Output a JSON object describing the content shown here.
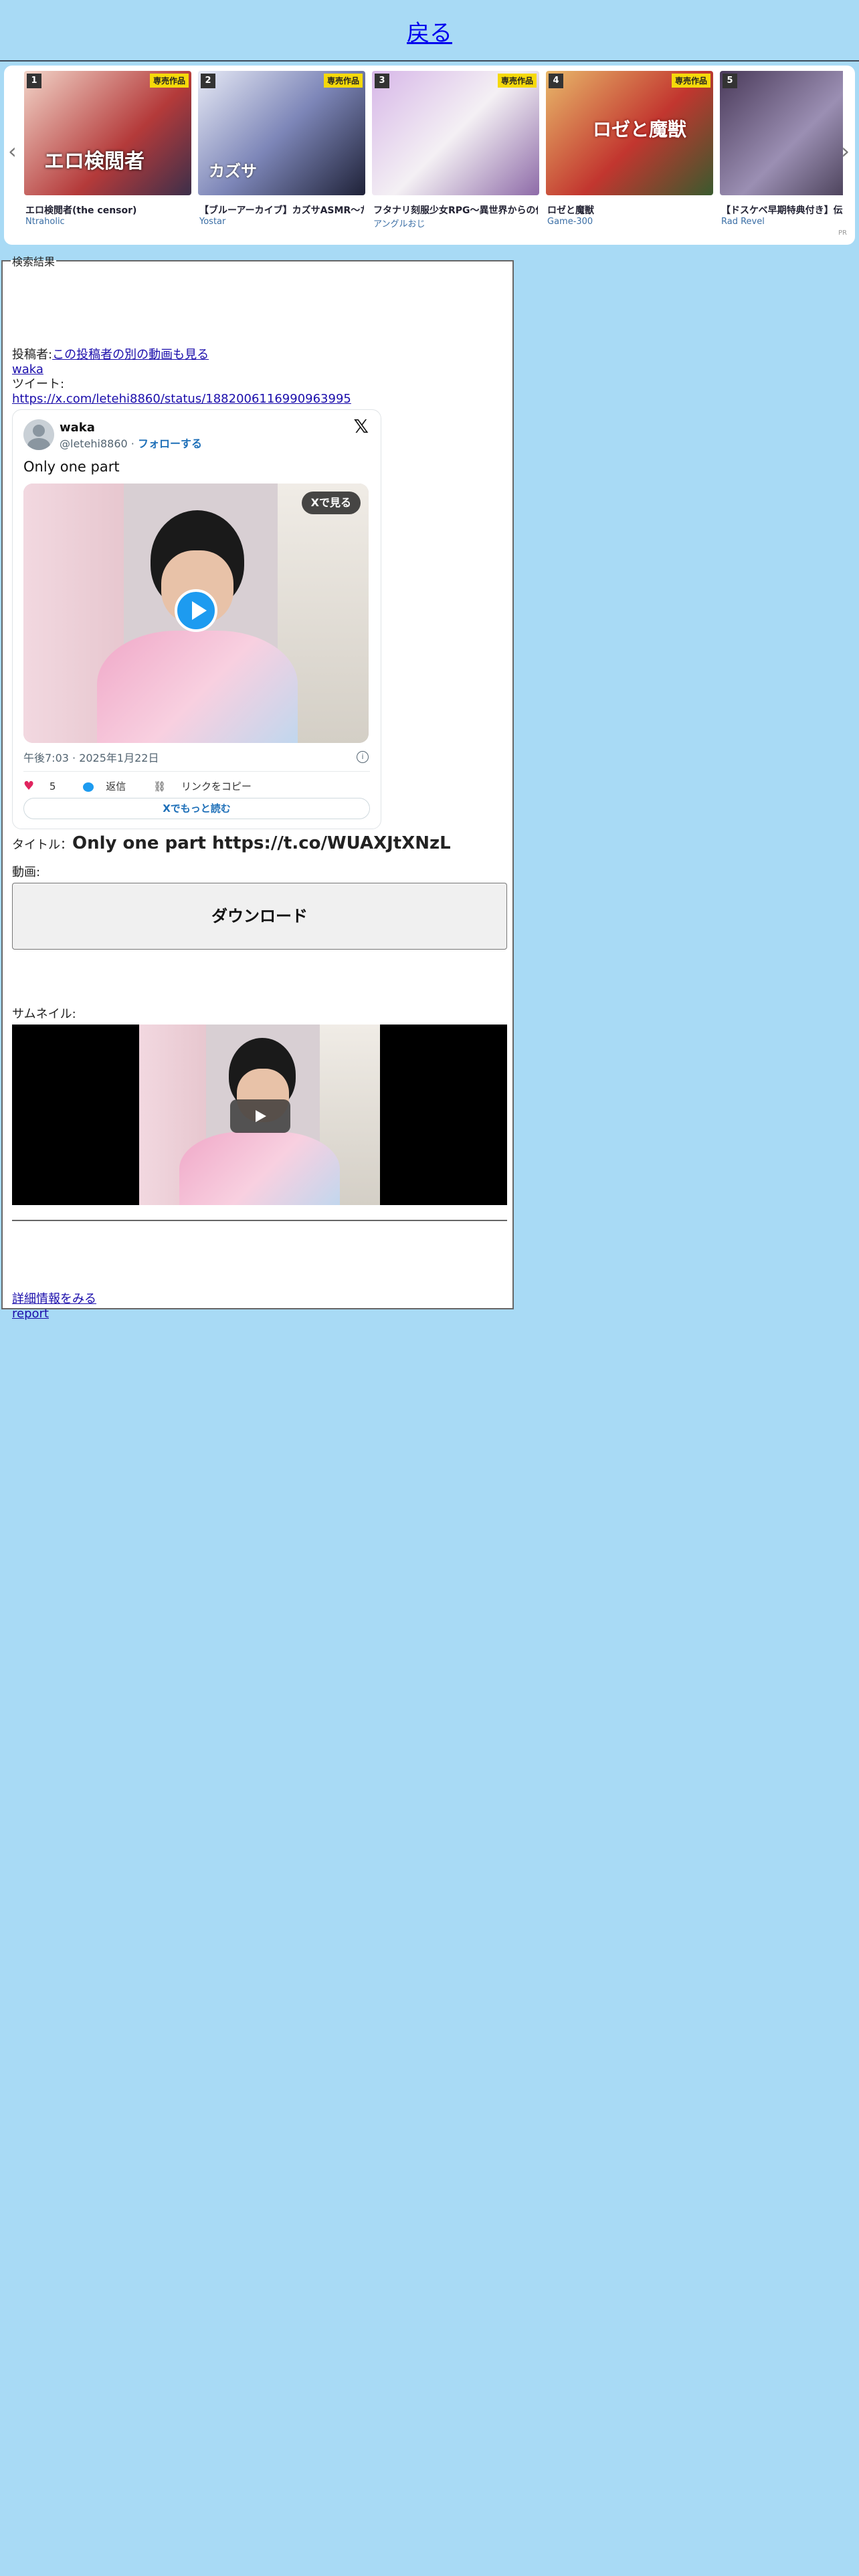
{
  "header": {
    "back_label": "戻る"
  },
  "carousel": {
    "pr_label": "PR",
    "badge_label": "専売作品",
    "items": [
      {
        "rank": "1",
        "title": "エロ検閲者(the censor)",
        "maker": "Ntraholic",
        "thumb_text": "エロ検閲者"
      },
      {
        "rank": "2",
        "title": "【ブルーアーカイブ】カズサASMR～ただ",
        "maker": "Yostar",
        "thumb_text": "カズサ"
      },
      {
        "rank": "3",
        "title": "フタナリ刻服少女RPG～異世界からの侵",
        "maker": "アングルおじ",
        "thumb_text": ""
      },
      {
        "rank": "4",
        "title": "ロゼと魔獣",
        "maker": "Game-300",
        "thumb_text": "ロゼと魔獣"
      },
      {
        "rank": "5",
        "title": "【ドスケベ早期特典付き】伝",
        "maker": "Rad Revel",
        "thumb_text": ""
      }
    ]
  },
  "results": {
    "legend": "検索結果",
    "poster_label": "投稿者:",
    "poster_link": "この投稿者の別の動画も見る",
    "poster_name": "waka",
    "tweet_label": "ツイート:",
    "tweet_url": "https://x.com/letehi8860/status/1882006116990963995",
    "embed": {
      "name": "waka",
      "handle": "@letehi8860 · ",
      "follow": "フォローする",
      "text": "Only one part",
      "watch_on_x": "Xで見る",
      "date": "午後7:03 · 2025年1月22日",
      "likes": "5",
      "reply": "返信",
      "copy_link": "リンクをコピー",
      "read_more": "Xでもっと読む"
    },
    "title_label": "タイトル：",
    "title_value": "Only one part https://t.co/WUAXJtXNzL",
    "video_label": "動画:",
    "download_label": "ダウンロード",
    "thumbnail_label": "サムネイル:",
    "details_link": "詳細情報をみる",
    "report_link": "report"
  }
}
